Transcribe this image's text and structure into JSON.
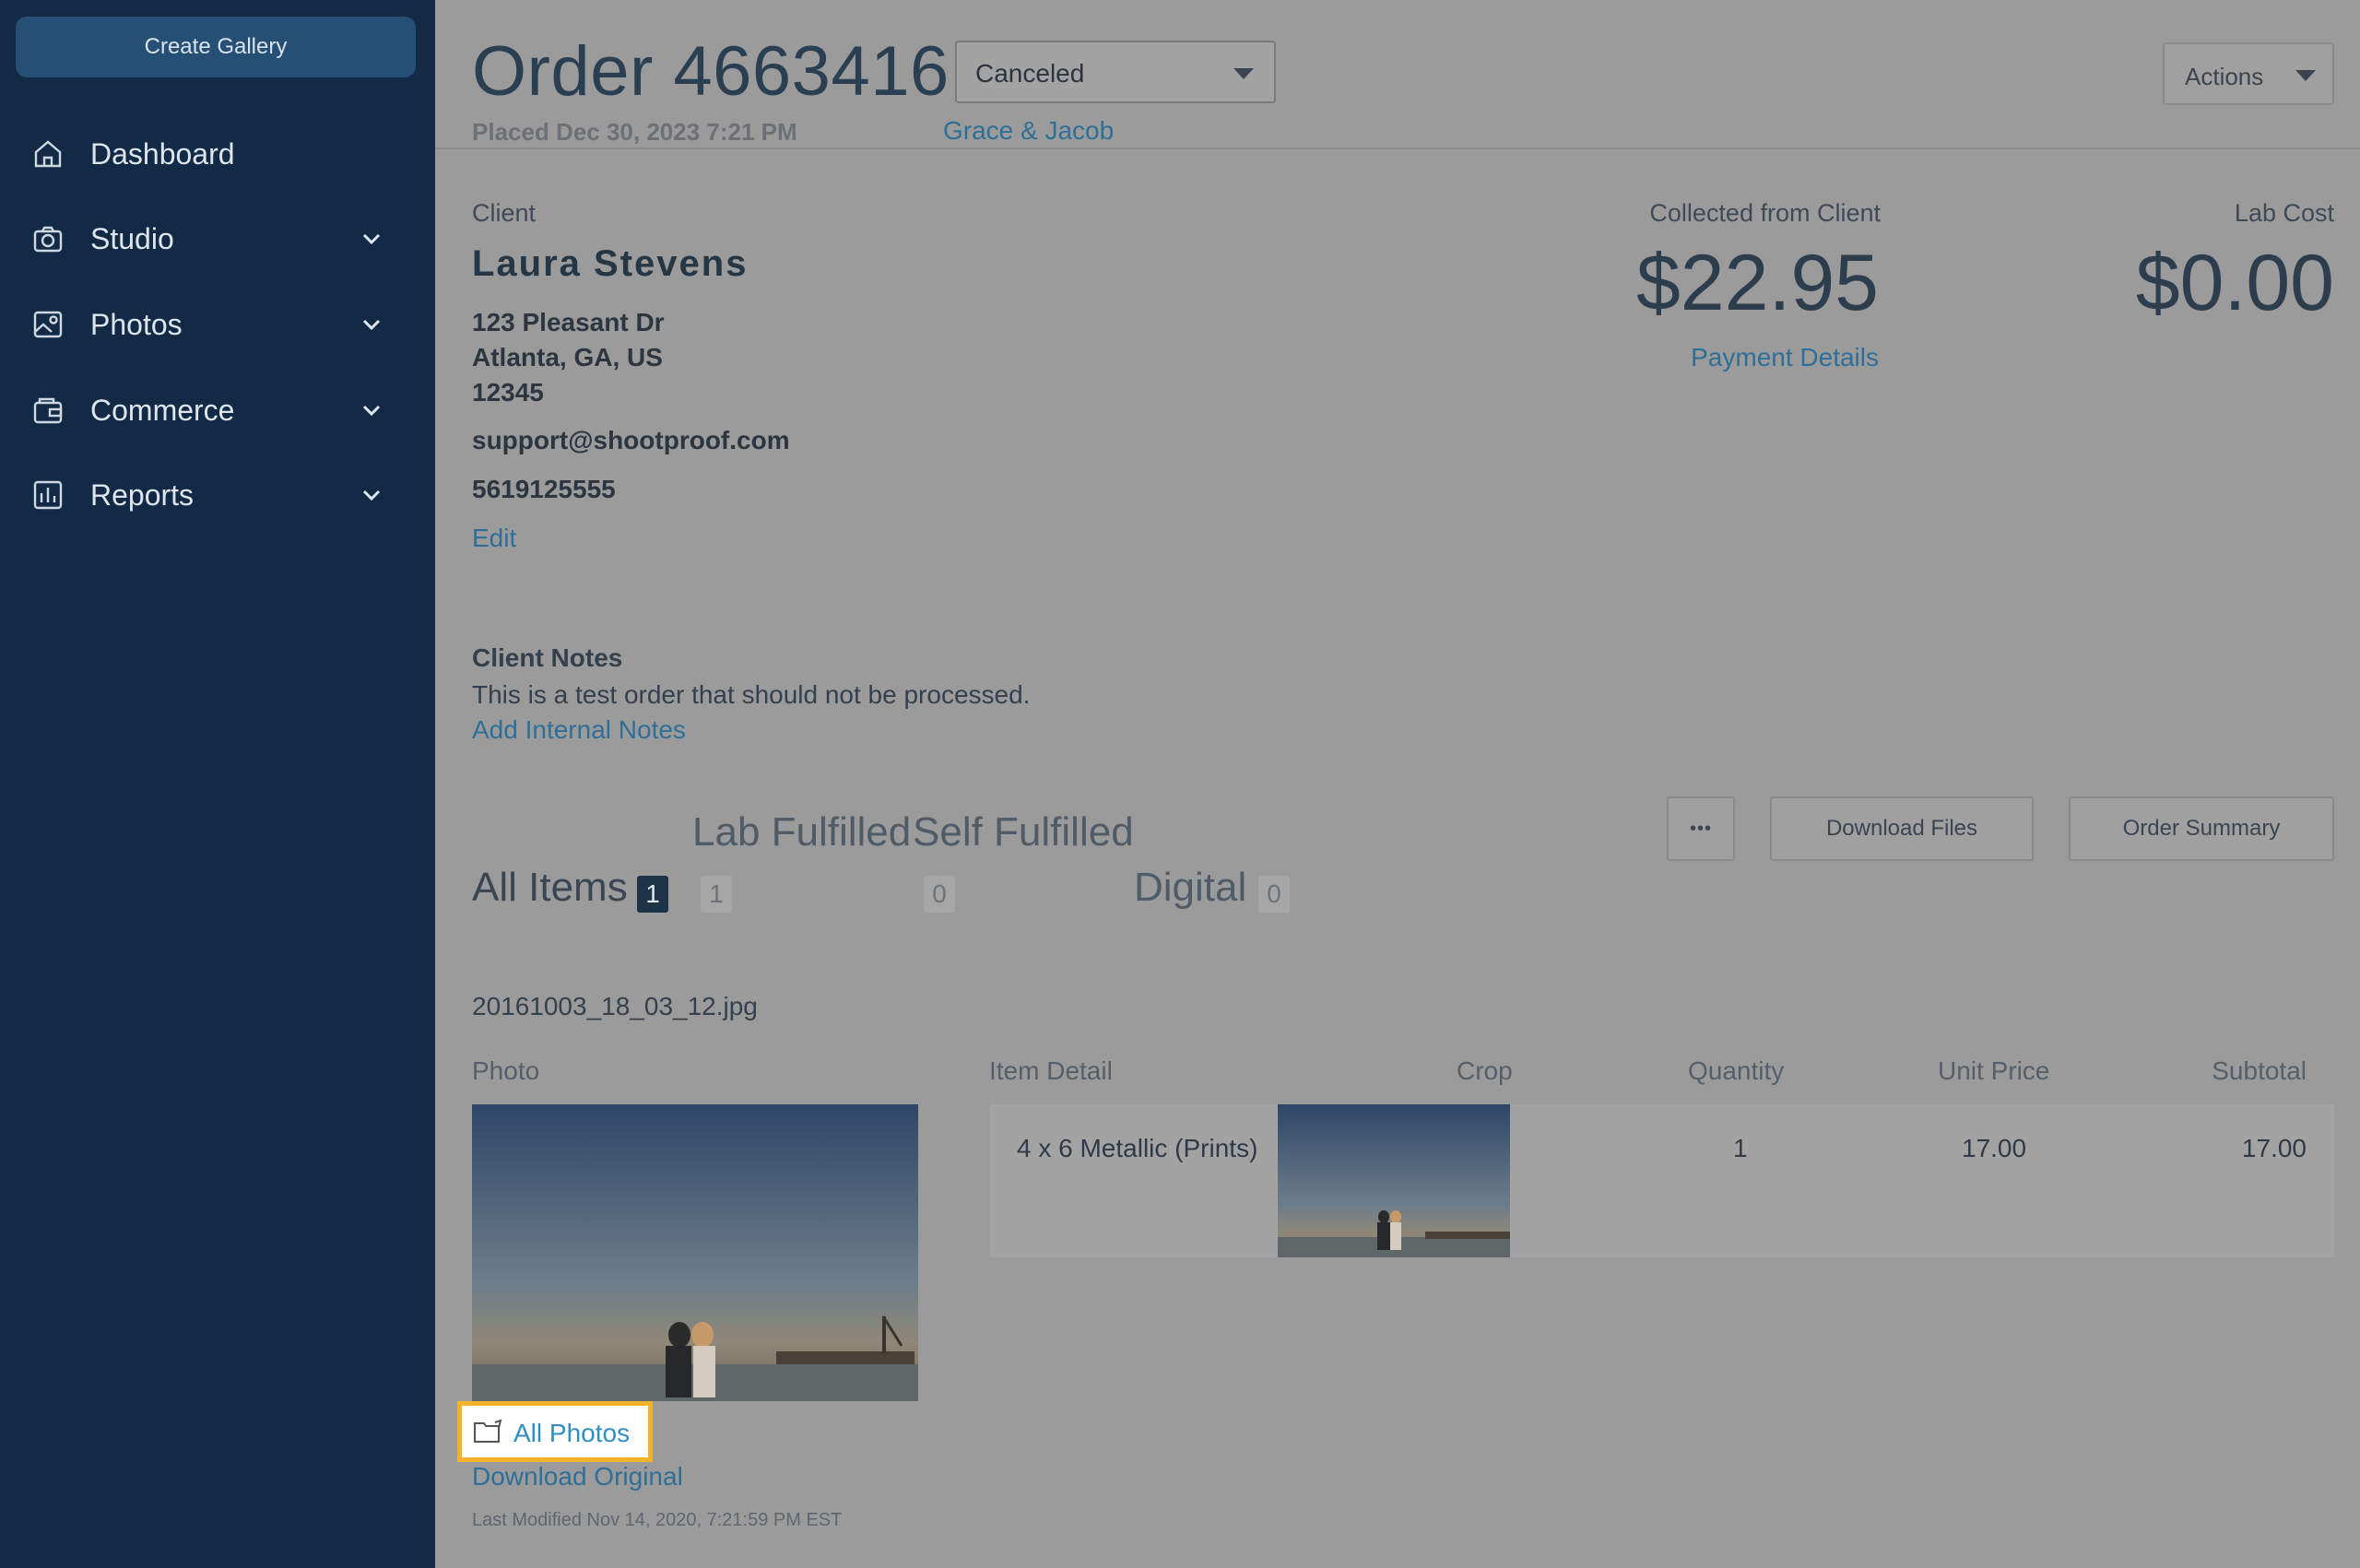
{
  "sidebar": {
    "create_gallery": "Create Gallery",
    "items": [
      {
        "label": "Dashboard",
        "icon": "home-icon",
        "has_children": false
      },
      {
        "label": "Studio",
        "icon": "camera-icon",
        "has_children": true
      },
      {
        "label": "Photos",
        "icon": "photo-icon",
        "has_children": true
      },
      {
        "label": "Commerce",
        "icon": "wallet-icon",
        "has_children": true
      },
      {
        "label": "Reports",
        "icon": "bar-chart-icon",
        "has_children": true
      }
    ]
  },
  "header": {
    "title": "Order 4663416",
    "status": "Canceled",
    "placed": "Placed Dec 30, 2023 7:21 PM",
    "gallery": "Grace & Jacob",
    "actions": "Actions"
  },
  "client": {
    "label": "Client",
    "name": "Laura Stevens",
    "address_line1": "123 Pleasant Dr",
    "address_line2": "Atlanta, GA, US",
    "zip": "12345",
    "email": "support@shootproof.com",
    "phone": "5619125555",
    "edit": "Edit"
  },
  "totals": {
    "collected_label": "Collected from Client",
    "collected_amount": "$22.95",
    "payment_details": "Payment Details",
    "lab_cost_label": "Lab Cost",
    "lab_cost_amount": "$0.00"
  },
  "notes": {
    "title": "Client Notes",
    "text": "This is a test order that should not be processed.",
    "add_internal": "Add Internal Notes"
  },
  "tabs": {
    "lab_fulfilled": "Lab Fulfilled",
    "self_fulfilled": "Self Fulfilled",
    "all_items": "All Items",
    "all_items_count": "1",
    "lab_count": "1",
    "self_count": "0",
    "digital": "Digital",
    "digital_count": "0",
    "more": "•••",
    "download_files": "Download Files",
    "order_summary": "Order Summary"
  },
  "item": {
    "filename": "20161003_18_03_12.jpg",
    "columns": [
      "Photo",
      "Item Detail",
      "Crop",
      "Quantity",
      "Unit Price",
      "Subtotal"
    ],
    "detail": "4 x 6 Metallic (Prints)",
    "quantity": "1",
    "unit_price": "17.00",
    "subtotal": "17.00",
    "all_photos": "All Photos",
    "download_original": "Download Original",
    "last_modified": "Last Modified Nov 14, 2020, 7:21:59 PM EST"
  },
  "colors": {
    "sidebar_bg": "#122a45",
    "link": "#2f6f97",
    "highlight": "#f3b329"
  }
}
